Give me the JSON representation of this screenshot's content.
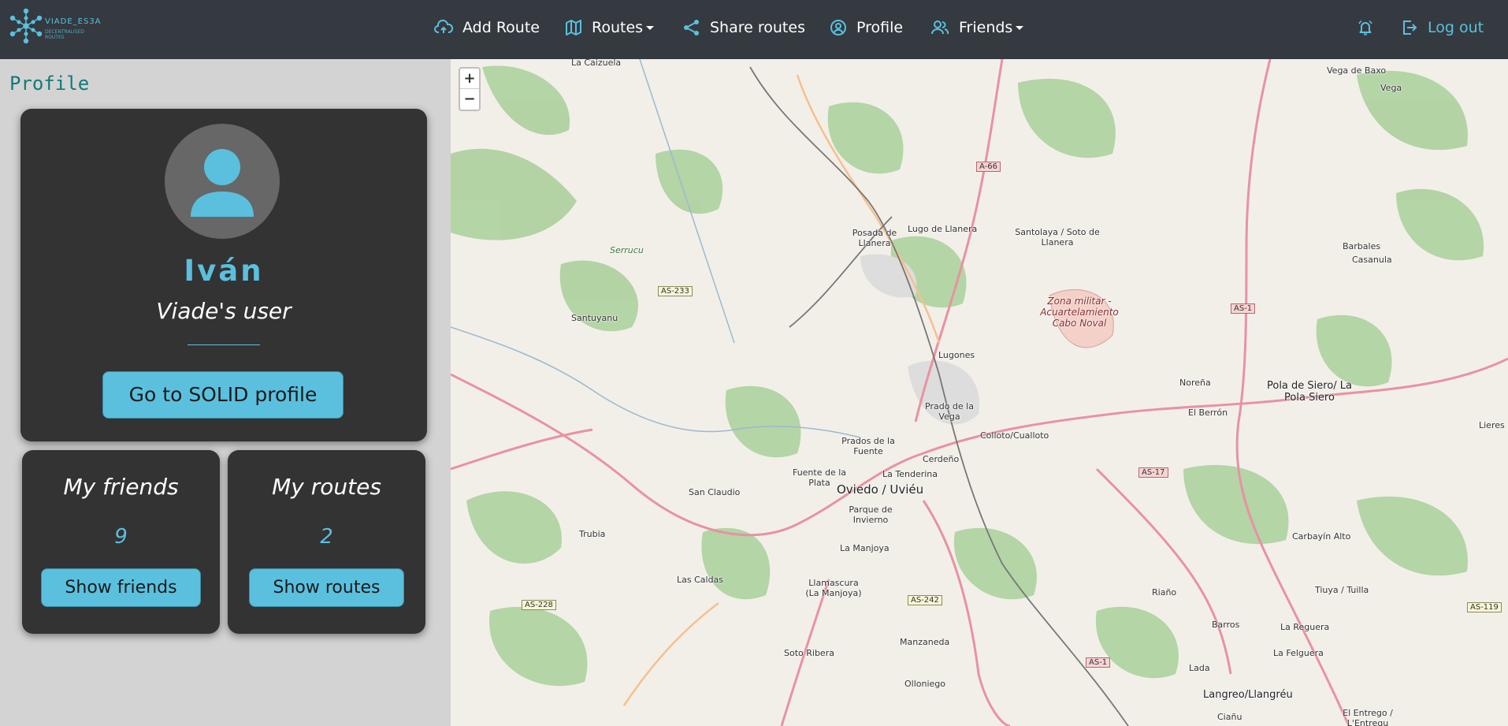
{
  "brand": {
    "name": "VIADE_ES3A",
    "tagline": "DECENTRALISED ROUTES"
  },
  "nav": {
    "add_route": "Add Route",
    "routes": "Routes",
    "share_routes": "Share routes",
    "profile": "Profile",
    "friends": "Friends",
    "logout": "Log out"
  },
  "page": {
    "heading": "Profile"
  },
  "profile": {
    "name": "Iván",
    "subtitle": "Viade's user",
    "solid_button": "Go to SOLID profile"
  },
  "friends_card": {
    "title": "My friends",
    "count": "9",
    "button": "Show friends"
  },
  "routes_card": {
    "title": "My routes",
    "count": "2",
    "button": "Show routes"
  },
  "map": {
    "zoom_in": "+",
    "zoom_out": "−",
    "labels": {
      "la_caizuela": "La Caizuela",
      "vega_de_baxo": "Vega de Baxo",
      "vega": "Vega",
      "posada": "Posada de Llanera",
      "lugo": "Lugo de Llanera",
      "santolaya": "Santolaya / Soto de Llanera",
      "serrucu": "Serrucu",
      "santuyanu": "Santuyanu",
      "barbales": "Barbales",
      "casanula": "Casanula",
      "zona_militar": "Zona militar - Acuartelamiento Cabo Noval",
      "lugones": "Lugones",
      "norena": "Noreña",
      "pola_siero": "Pola de Siero/ La Pola Siero",
      "prado_vega": "Prado de la Vega",
      "el_berron": "El Berrón",
      "lieres": "Lieres",
      "colloto": "Colloto/Cualloto",
      "prados_fuente": "Prados de la Fuente",
      "cerdeno": "Cerdeño",
      "la_tenderina": "La Tenderina",
      "fuente_plata": "Fuente de la Plata",
      "oviedo": "Oviedo / Uviéu",
      "san_claudio": "San Claudio",
      "parque_invierno": "Parque de Invierno",
      "trubia": "Trubia",
      "la_manjoya": "La Manjoya",
      "carbayin": "Carbayín Alto",
      "las_caldas": "Las Caldas",
      "llamascura": "Llamascura (La Manjoya)",
      "tiuya": "Tiuya / Tuilla",
      "riano": "Riaño",
      "barros": "Barros",
      "la_reguera": "La Reguera",
      "la_felguera": "La Felguera",
      "manzaneda": "Manzaneda",
      "soto_ribera": "Soto Ribera",
      "lada": "Lada",
      "olloniego": "Olloniego",
      "langreo": "Langreo/Llangréu",
      "cianu": "Ciañu",
      "el_entrego": "El Entrego / L'Entregu"
    },
    "shields": {
      "a66": "A-66",
      "as233": "AS-233",
      "as1a": "AS-1",
      "as17": "AS-17",
      "as242": "AS-242",
      "as228": "AS-228",
      "as1b": "AS-1",
      "as119": "AS-119"
    }
  }
}
